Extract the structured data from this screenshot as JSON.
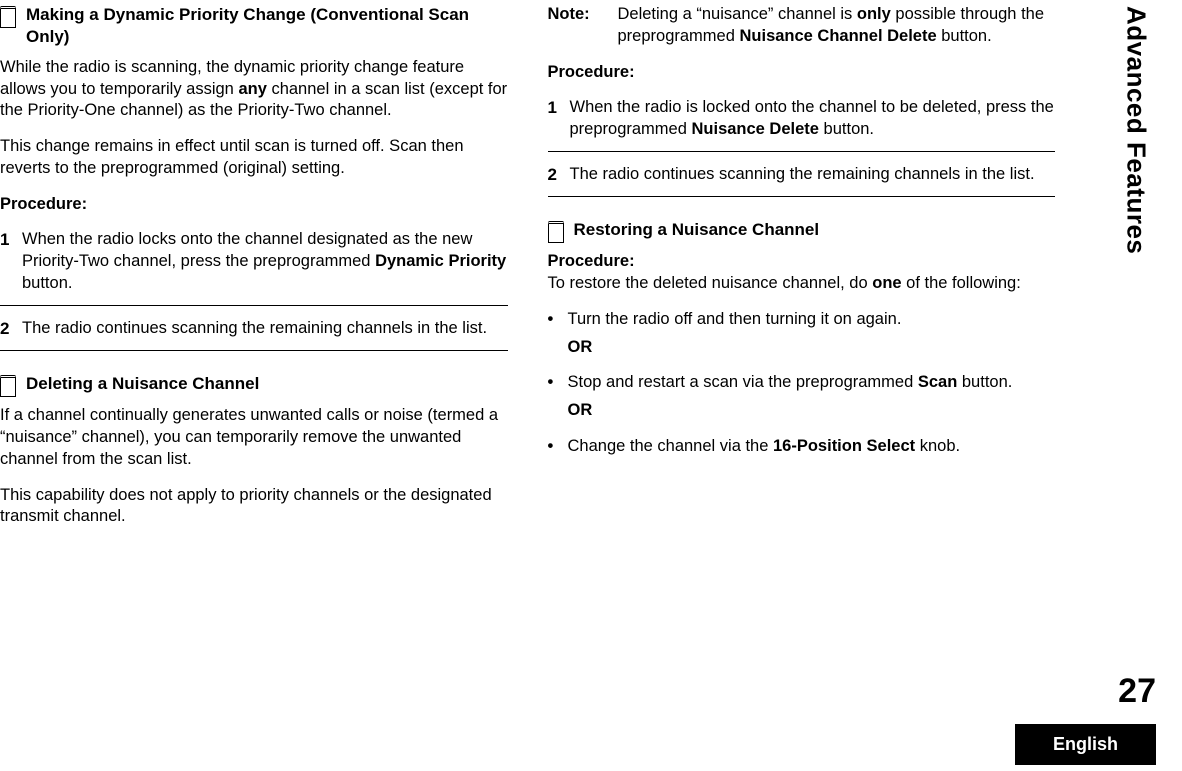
{
  "side_tab": "Advanced Features",
  "page_number": "27",
  "footer_language": "English",
  "left": {
    "sec1": {
      "title": "Making a Dynamic Priority Change (Conventional Scan Only)",
      "p1a": "While the radio is scanning, the dynamic priority change feature allows you to temporarily assign ",
      "p1b_bold": "any",
      "p1c": " channel in a scan list (except for the Priority-One channel) as the Priority-Two channel.",
      "p2": "This change remains in effect until scan is turned off. Scan then reverts to the preprogrammed (original) setting.",
      "proc": "Procedure:",
      "step1a": "When the radio locks onto the channel designated as the new Priority-Two channel, press the preprogrammed ",
      "step1b_bold": "Dynamic Priority",
      "step1c": " button.",
      "step2": "The radio continues scanning the remaining channels in the list."
    },
    "sec2": {
      "title": "Deleting a Nuisance Channel",
      "p1": "If a channel continually generates unwanted calls or noise (termed a “nuisance” channel), you can temporarily remove the unwanted channel from the scan list.",
      "p2": "This capability does not apply to priority channels or the designated transmit channel."
    }
  },
  "right": {
    "note": {
      "label": "Note:",
      "t1": "Deleting a “nuisance” channel is ",
      "t2_bold": "only",
      "t3": " possible through the preprogrammed ",
      "t4_bold": "Nuisance Channel Delete",
      "t5": " button."
    },
    "proc": "Procedure:",
    "step1a": "When the radio is locked onto the channel to be deleted, press the preprogrammed ",
    "step1b_bold": "Nuisance Delete",
    "step1c": " button.",
    "step2": "The radio continues scanning the remaining channels in the list.",
    "sec3": {
      "title": "Restoring a Nuisance Channel",
      "proc": "Procedure:",
      "intro_a": "To restore the deleted nuisance channel, do ",
      "intro_b_bold": "one",
      "intro_c": " of the following:",
      "b1": "Turn the radio off and then turning it on again.",
      "or": "OR",
      "b2a": "Stop and restart a scan via the preprogrammed ",
      "b2b_bold": "Scan",
      "b2c": " button.",
      "b3a": "Change the channel via the ",
      "b3b_bold": "16-Position Select",
      "b3c": " knob."
    }
  }
}
